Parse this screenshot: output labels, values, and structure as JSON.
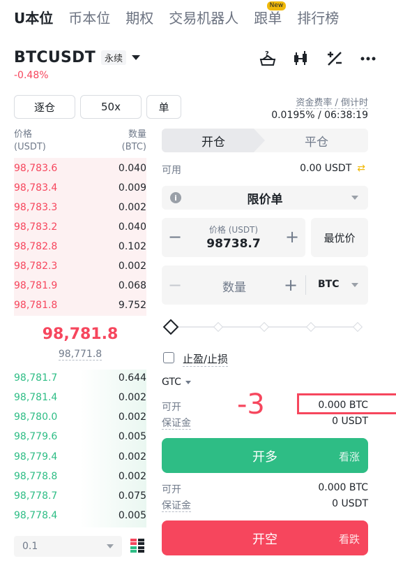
{
  "top_tabs": [
    {
      "label": "U本位",
      "active": true
    },
    {
      "label": "币本位",
      "active": false
    },
    {
      "label": "期权",
      "active": false
    },
    {
      "label": "交易机器人",
      "active": false
    },
    {
      "label": "跟单",
      "active": false,
      "badge": "New"
    },
    {
      "label": "排行榜",
      "active": false
    }
  ],
  "header": {
    "symbol": "BTCUSDT",
    "contract_tag": "永续",
    "change": "-0.48%",
    "icons": [
      "promo-gift-icon",
      "candlestick-icon",
      "calculator-icon",
      "more-icon"
    ]
  },
  "controls": {
    "margin_mode": "逐仓",
    "leverage": "50x",
    "position_mode": "单",
    "funding_label": "资金费率 / 倒计时",
    "funding_value": "0.0195% / 06:38:19"
  },
  "orderbook": {
    "price_header": "价格",
    "price_unit": "(USDT)",
    "qty_header": "数量",
    "qty_unit": "(BTC)",
    "asks": [
      {
        "price": "98,783.6",
        "qty": "0.040"
      },
      {
        "price": "98,783.4",
        "qty": "0.009"
      },
      {
        "price": "98,783.3",
        "qty": "0.002"
      },
      {
        "price": "98,783.2",
        "qty": "0.040"
      },
      {
        "price": "98,782.8",
        "qty": "0.102"
      },
      {
        "price": "98,782.3",
        "qty": "0.002"
      },
      {
        "price": "98,781.9",
        "qty": "0.068"
      },
      {
        "price": "98,781.8",
        "qty": "9.752"
      }
    ],
    "last_price": "98,781.8",
    "mark_price": "98,771.8",
    "bids": [
      {
        "price": "98,781.7",
        "qty": "0.644"
      },
      {
        "price": "98,781.4",
        "qty": "0.002"
      },
      {
        "price": "98,780.0",
        "qty": "0.002"
      },
      {
        "price": "98,779.6",
        "qty": "0.005"
      },
      {
        "price": "98,779.4",
        "qty": "0.002"
      },
      {
        "price": "98,778.8",
        "qty": "0.002"
      },
      {
        "price": "98,778.7",
        "qty": "0.075"
      },
      {
        "price": "98,778.4",
        "qty": "0.005"
      }
    ],
    "depth": "0.1"
  },
  "order_form": {
    "tab_open": "开仓",
    "tab_close": "平仓",
    "available_label": "可用",
    "available_value": "0.00 USDT",
    "order_type": "限价单",
    "price_label": "价格 (USDT)",
    "price_value": "98738.7",
    "best_price": "最优价",
    "qty_placeholder": "数量",
    "qty_unit": "BTC",
    "slider_level": 0,
    "tpsl_label": "止盈/止损",
    "tif": "GTC",
    "buy_info": {
      "open_label": "可开",
      "open_value": "0.000 BTC",
      "margin_label": "保证金",
      "margin_value": "0 USDT"
    },
    "sell_info": {
      "open_label": "可开",
      "open_value": "0.000 BTC",
      "margin_label": "保证金",
      "margin_value": "0 USDT"
    },
    "buy_label": "开多",
    "buy_sub": "看涨",
    "sell_label": "开空",
    "sell_sub": "看跌"
  },
  "annotation": {
    "text": "-3",
    "color": "#f6465d"
  }
}
